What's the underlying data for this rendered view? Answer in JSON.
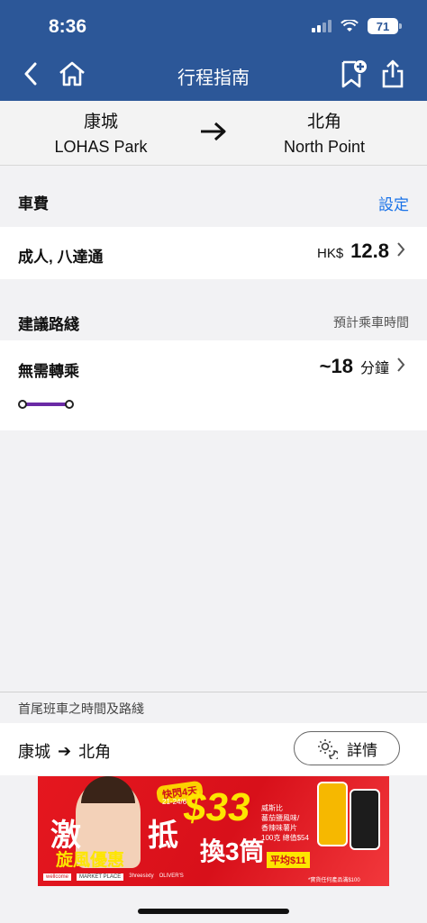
{
  "status": {
    "time": "8:36",
    "battery": "71"
  },
  "nav": {
    "title": "行程指南"
  },
  "route": {
    "from_zh": "康城",
    "from_en": "LOHAS Park",
    "to_zh": "北角",
    "to_en": "North Point"
  },
  "fare": {
    "section_title": "車費",
    "settings_label": "設定",
    "ticket_type": "成人, 八達通",
    "currency": "HK$",
    "amount": "12.8"
  },
  "suggested": {
    "section_title": "建議路綫",
    "estimate_label": "預計乘車時間",
    "route_label": "無需轉乘",
    "duration": "~18",
    "duration_unit": "分鐘",
    "line_color": "#6a2aa5"
  },
  "first_last": {
    "section_title": "首尾班車之時間及路綫",
    "from": "康城",
    "arrow": "➔",
    "to": "北角",
    "detail_label": "詳情"
  },
  "ad": {
    "badge": "快閃4天",
    "dates": "21-24/6",
    "headline_1": "激",
    "headline_2": "抵",
    "subline": "旋風優惠",
    "price": "$33",
    "deal": "換3筒",
    "product": "威斯比\n蕃茄鹽風味/\n香辣味薯片\n100克 總值$54",
    "average": "平均$11",
    "disclaimer": "*實貨任何產品滿$100",
    "brands": [
      "wellcome",
      "MARKET PLACE",
      "3hreesixty",
      "OLIVER'S"
    ]
  }
}
